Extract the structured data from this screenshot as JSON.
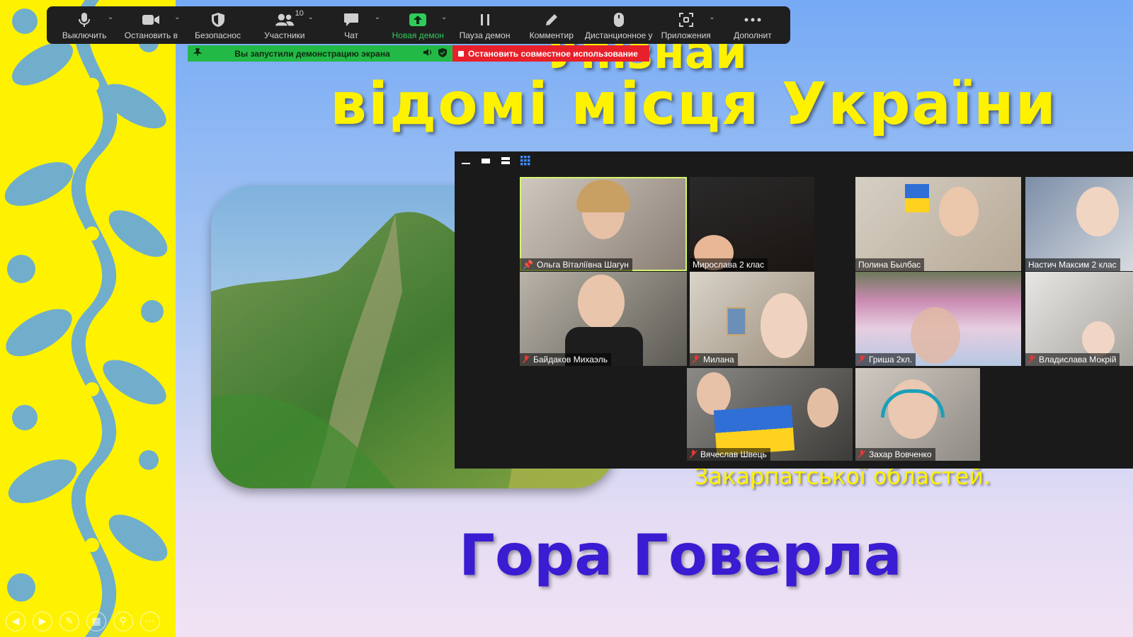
{
  "toolbar": {
    "items": [
      {
        "id": "mute",
        "label": "Выключить",
        "icon": "microphone-icon",
        "caret": true
      },
      {
        "id": "video",
        "label": "Остановить в",
        "icon": "video-camera-icon",
        "caret": true
      },
      {
        "id": "security",
        "label": "Безопаснос",
        "icon": "shield-icon",
        "caret": false
      },
      {
        "id": "participants",
        "label": "Участники",
        "icon": "participants-icon",
        "caret": true,
        "count": "10"
      },
      {
        "id": "chat",
        "label": "Чат",
        "icon": "chat-bubble-icon",
        "caret": true
      },
      {
        "id": "new-share",
        "label": "Новая демон",
        "icon": "share-screen-icon",
        "caret": true,
        "active": true
      },
      {
        "id": "pause-share",
        "label": "Пауза демон",
        "icon": "pause-icon",
        "caret": false
      },
      {
        "id": "annotate",
        "label": "Комментир",
        "icon": "pencil-icon",
        "caret": false
      },
      {
        "id": "remote-control",
        "label": "Дистанционное у",
        "icon": "mouse-icon",
        "caret": false
      },
      {
        "id": "apps",
        "label": "Приложения",
        "icon": "apps-icon",
        "caret": true
      },
      {
        "id": "more",
        "label": "Дополнит",
        "icon": "more-dots-icon",
        "caret": false
      }
    ],
    "accent_color": "#2ecc5a"
  },
  "share_bar": {
    "status": "Вы запустили демонстрацию экрана",
    "stop": "Остановить совместное использование",
    "green": "#23b946",
    "red": "#e8202a"
  },
  "slide": {
    "title_top": "Упізнай",
    "title_main": "відомі місця України",
    "subtitle": "Закарпатської областей.",
    "bottom_title": "Гора Говерла",
    "title_color": "#fff200",
    "bottom_color": "#3a1cd2",
    "nav": [
      "◀",
      "▶",
      "✎",
      "▦",
      "⚲",
      "⋯"
    ]
  },
  "gallery": {
    "participants": [
      {
        "name": "Ольга Віталіївна Шагун",
        "muted": false,
        "pinned": true,
        "speaking": true
      },
      {
        "name": "Мирослава 2 клас",
        "muted": false,
        "pinned": false
      },
      {
        "name": "Полина Былбас",
        "muted": false,
        "pinned": false
      },
      {
        "name": "Настич Максим 2 клас",
        "muted": false,
        "pinned": false
      },
      {
        "name": "Байдаков Михаэль",
        "muted": true,
        "pinned": false
      },
      {
        "name": "Милана",
        "muted": true,
        "pinned": false
      },
      {
        "name": "Гриша 2кл.",
        "muted": true,
        "pinned": false
      },
      {
        "name": "Владислава Мокрій",
        "muted": true,
        "pinned": false
      },
      {
        "name": "Вячеслав Швець",
        "muted": true,
        "pinned": false
      },
      {
        "name": "Захар Вовченко",
        "muted": true,
        "pinned": false
      }
    ]
  }
}
